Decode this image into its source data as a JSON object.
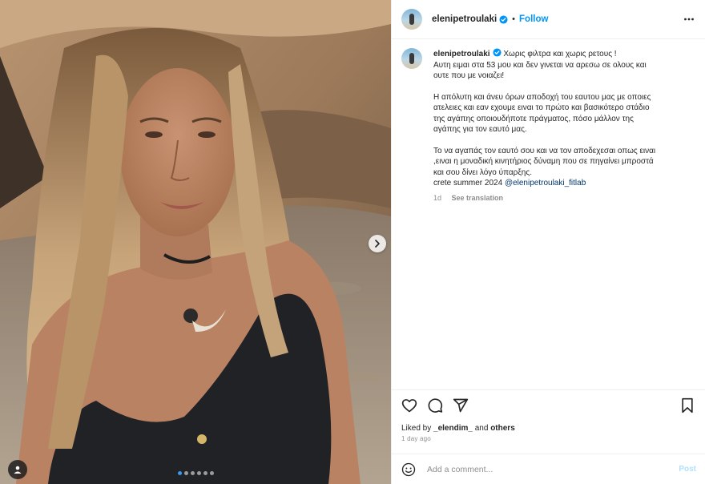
{
  "post": {
    "username": "elenipetroulaki",
    "follow_label": "Follow",
    "separator": "•",
    "caption": {
      "line1": "Χωρις φιλτρα και χωρις ρετους !",
      "line2": "Αυτη ειμαι στα 53 μου και δεν γινεται να αρεσω σε ολους και",
      "line3": "ουτε που με νοιαζει!",
      "para2_line1": "Η απόλυτη και άνευ όρων αποδοχή του εαυτου μας με οποιες",
      "para2_line2": "ατελειες και εαν εχουμε ειναι το πρώτο και βασικότερο στάδιο",
      "para2_line3": "της αγάπης οποιουδήποτε πράγματος, πόσο μάλλον της",
      "para2_line4": "αγάπης για τον εαυτό μας.",
      "para3_line1": "Το να αγαπάς τον εαυτό σου και να τον αποδεχεσαι οπως ειναι",
      "para3_line2": ",ειναι η μοναδική κινητήριος δύναμη που σε πηγαίνει μπροστά",
      "para3_line3": "και σου δίνει λόγο ύπαρξης.",
      "para3_line4": "crete summer 2024",
      "mention": "@elenipetroulaki_fitlab"
    },
    "time_short": "1d",
    "see_translation": "See translation",
    "likes_prefix": "Liked by",
    "liked_by_user": "_elendim_",
    "likes_and": "and",
    "likes_others": "others",
    "time_ago": "1 day ago",
    "comment_placeholder": "Add a comment...",
    "post_label": "Post"
  },
  "carousel": {
    "count": 6,
    "active_index": 0
  },
  "colors": {
    "accent": "#0095f6",
    "verified": "#0095f6",
    "post_disabled": "#b2dffc",
    "muted": "#8e8e8e"
  },
  "icons": {
    "like": "heart-icon",
    "comment": "comment-icon",
    "share": "share-icon",
    "save": "bookmark-icon",
    "more": "more-icon",
    "emoji": "emoji-icon",
    "next": "chevron-right-icon",
    "tag": "user-tag-icon"
  }
}
